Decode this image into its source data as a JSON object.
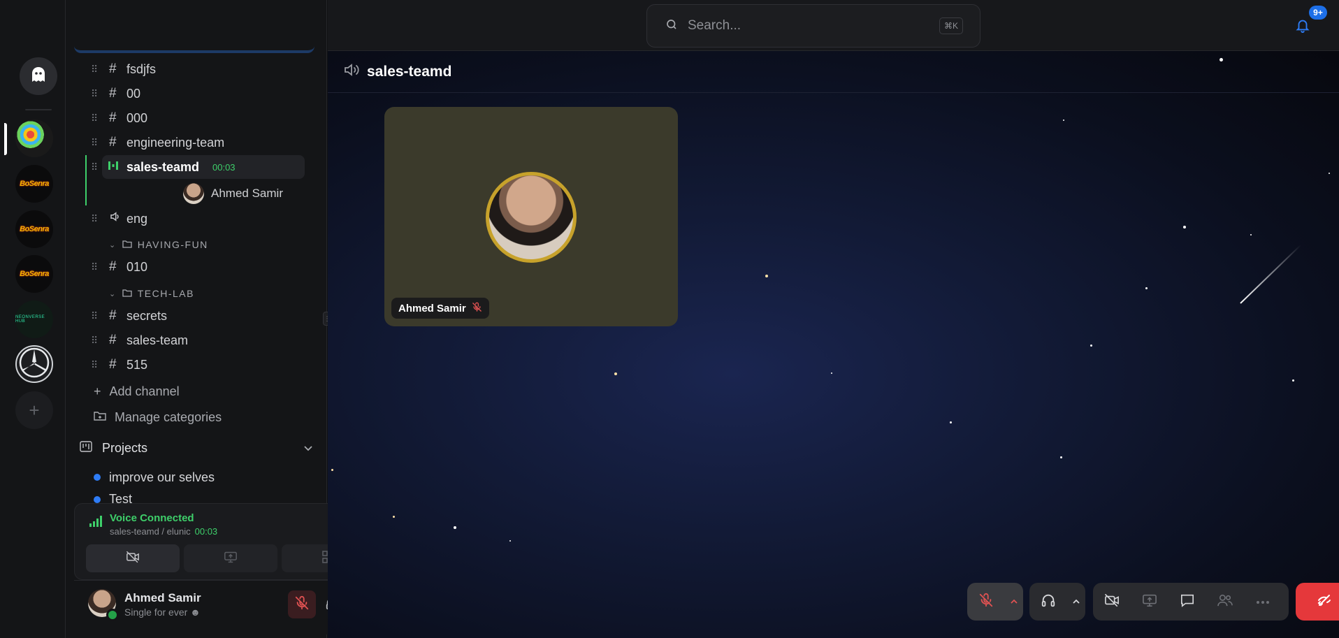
{
  "rail": {
    "servers": [
      "server-1",
      "BoSenra",
      "BoSenra",
      "BoSenra",
      "server-5",
      "server-6"
    ],
    "bosenra_label": "BoSenra",
    "server5_label": "NEONVERSE HUB",
    "add_label": "+"
  },
  "sidebar": {
    "channels": [
      {
        "label": "fsdjfs",
        "type": "text"
      },
      {
        "label": "00",
        "type": "text"
      },
      {
        "label": "000",
        "type": "text"
      },
      {
        "label": "engineering-team",
        "type": "text"
      },
      {
        "label": "sales-teamd",
        "type": "voice-active",
        "timer": "00:03"
      },
      {
        "label": "eng",
        "type": "voice"
      },
      {
        "label": "010",
        "type": "text"
      },
      {
        "label": "secrets",
        "type": "text"
      },
      {
        "label": "sales-team",
        "type": "text"
      },
      {
        "label": "515",
        "type": "text"
      }
    ],
    "voice_member": {
      "name": "Ahmed Samir",
      "muted": true
    },
    "categories": [
      "HAVING-FUN",
      "TECH-LAB"
    ],
    "add_channel": "Add channel",
    "manage_categories": "Manage categories",
    "projects": {
      "title": "Projects",
      "items": [
        "improve our selves",
        "Test"
      ]
    },
    "voice_panel": {
      "title": "Voice Connected",
      "subtitle": "sales-teamd / elunic",
      "timer": "00:03"
    },
    "user": {
      "name": "Ahmed Samir",
      "status": "Single for ever ☻"
    }
  },
  "main": {
    "search": {
      "placeholder": "Search...",
      "shortcut": "⌘K"
    },
    "notifications_badge": "9+",
    "channel_title": "sales-teamd",
    "tile": {
      "name": "Ahmed Samir",
      "muted": true
    }
  },
  "colors": {
    "accent_green": "#3ecf6a",
    "accent_blue": "#1d6fe8",
    "danger_red": "#e5383b",
    "mute_red": "#e05252"
  }
}
